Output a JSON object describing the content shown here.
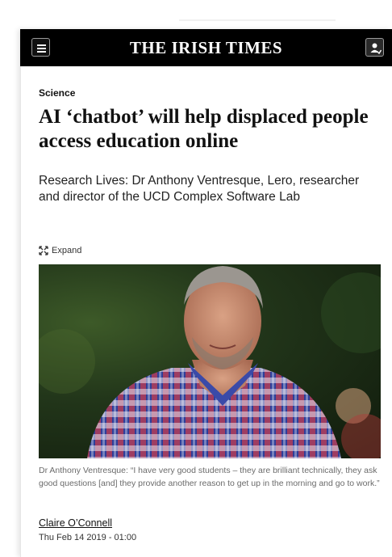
{
  "masthead": {
    "logo_text": "THE IRISH TIMES",
    "background": "#000000"
  },
  "article": {
    "section": "Science",
    "headline": "AI ‘chatbot’ will help displaced people access education online",
    "standfirst": "Research Lives: Dr Anthony Ventresque, Lero, researcher and director of the UCD Complex Software Lab",
    "expand_label": "Expand",
    "caption": "Dr Anthony Ventresque: “I have very good students – they are brilliant technically, they ask good questions [and] they provide another reason to get up in the morning and go to work.”",
    "author": "Claire O’Connell",
    "date": "Thu Feb 14 2019 - 01:00"
  },
  "icons": {
    "menu": "hamburger-menu-icon",
    "account": "user-account-icon",
    "expand": "expand-arrows-icon"
  }
}
